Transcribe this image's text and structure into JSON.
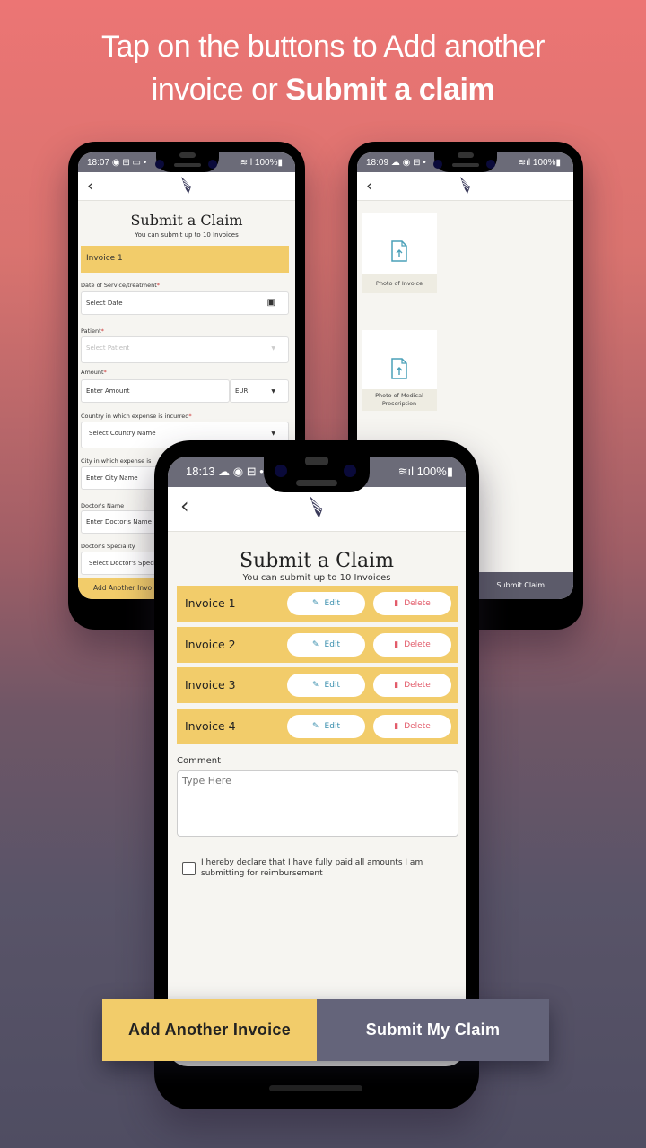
{
  "headline": {
    "line1": "Tap on the buttons to Add another",
    "line2_regular": "invoice or ",
    "line2_bold": "Submit a claim"
  },
  "phone_left": {
    "status": {
      "time": "18:07",
      "icons_left": "◉ ⊟ ▭ •",
      "battery": "100%",
      "signal": "wifi-signal-icon"
    },
    "title": "Submit a Claim",
    "subtitle": "You can submit up to 10 Invoices",
    "invoice_header": "Invoice 1",
    "fields": [
      {
        "label": "Date of Service/treatment",
        "required": "*",
        "value": "Select Date"
      },
      {
        "label": "Patient",
        "required": "*",
        "value": "Select Patient"
      },
      {
        "label": "Amount",
        "required": "*",
        "value": "Enter Amount",
        "currency": "EUR"
      },
      {
        "label": "Country in which expense is incurred",
        "required": "*",
        "value": "Select Country Name"
      },
      {
        "label": "City in which expense is",
        "required": "",
        "value": "Enter City Name"
      },
      {
        "label": "Doctor's Name",
        "required": "",
        "value": "Enter Doctor's Name"
      },
      {
        "label": "Doctor's Speciality",
        "required": "",
        "value": "Select Doctor's Speci"
      }
    ],
    "footer_button": "Add Another Invo"
  },
  "phone_right": {
    "status": {
      "time": "18:09",
      "icons_left": "☁ ◉ ⊟ •",
      "battery": "100%"
    },
    "uploads": [
      {
        "caption": "Photo of Invoice"
      },
      {
        "caption": "Photo of Medical Prescription"
      }
    ],
    "footer_button": "Submit Claim"
  },
  "phone_front": {
    "status": {
      "time": "18:13",
      "icons_left": "☁ ◉ ⊟ •",
      "battery": "100%"
    },
    "title": "Submit a Claim",
    "subtitle": "You can submit up to 10 Invoices",
    "invoices": [
      {
        "name": "Invoice 1",
        "edit": "Edit",
        "delete": "Delete"
      },
      {
        "name": "Invoice 2",
        "edit": "Edit",
        "delete": "Delete"
      },
      {
        "name": "Invoice 3",
        "edit": "Edit",
        "delete": "Delete"
      },
      {
        "name": "Invoice 4",
        "edit": "Edit",
        "delete": "Delete"
      }
    ],
    "comment_label": "Comment",
    "comment_placeholder": "Type Here",
    "declaration": "I hereby declare that I have fully paid all amounts I am submitting for reimbursement",
    "declaration_checked": false
  },
  "actions": {
    "add_invoice": "Add Another Invoice",
    "submit_claim": "Submit My Claim"
  },
  "colors": {
    "accent_yellow": "#f2cc6a",
    "submit_gray": "#64647a",
    "edit_blue": "#3b8fae",
    "delete_red": "#e25b6a"
  }
}
